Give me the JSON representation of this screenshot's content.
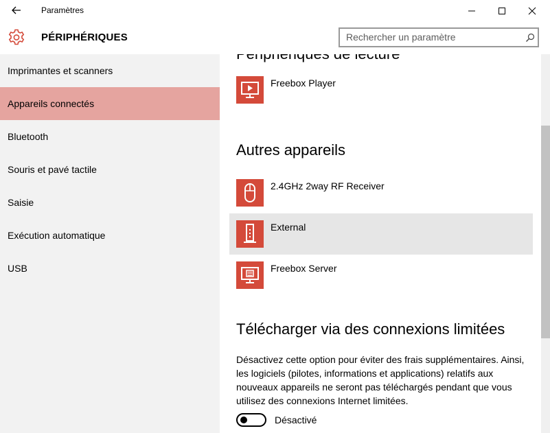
{
  "window": {
    "title": "Paramètres"
  },
  "header": {
    "section_title": "PÉRIPHÉRIQUES",
    "search_placeholder": "Rechercher un paramètre"
  },
  "sidebar": {
    "items": [
      {
        "label": "Imprimantes et scanners"
      },
      {
        "label": "Appareils connectés",
        "selected": true
      },
      {
        "label": "Bluetooth"
      },
      {
        "label": "Souris et pavé tactile"
      },
      {
        "label": "Saisie"
      },
      {
        "label": "Exécution automatique"
      },
      {
        "label": "USB"
      }
    ]
  },
  "content": {
    "playback_heading": "Périphériques de lecture",
    "playback_devices": [
      {
        "name": "Freebox Player",
        "icon": "monitor-play-icon"
      }
    ],
    "other_heading": "Autres appareils",
    "other_devices": [
      {
        "name": "2.4GHz 2way RF Receiver",
        "icon": "mouse-icon"
      },
      {
        "name": "External",
        "icon": "usb-drive-icon"
      },
      {
        "name": "Freebox Server",
        "icon": "monitor-server-icon"
      }
    ],
    "metered_heading": "Télécharger via des connexions limitées",
    "metered_description": "Désactivez cette option pour éviter des frais supplémentaires. Ainsi, les logiciels (pilotes, informations et applications) relatifs aux nouveaux appareils ne seront pas téléchargés pendant que vous utilisez des connexions Internet limitées.",
    "metered_toggle_state": "Désactivé"
  },
  "colors": {
    "accent": "#d44a3a",
    "selected_nav": "#e5a49f",
    "sidebar_bg": "#f2f2f2",
    "hover_row": "#e6e6e6"
  }
}
